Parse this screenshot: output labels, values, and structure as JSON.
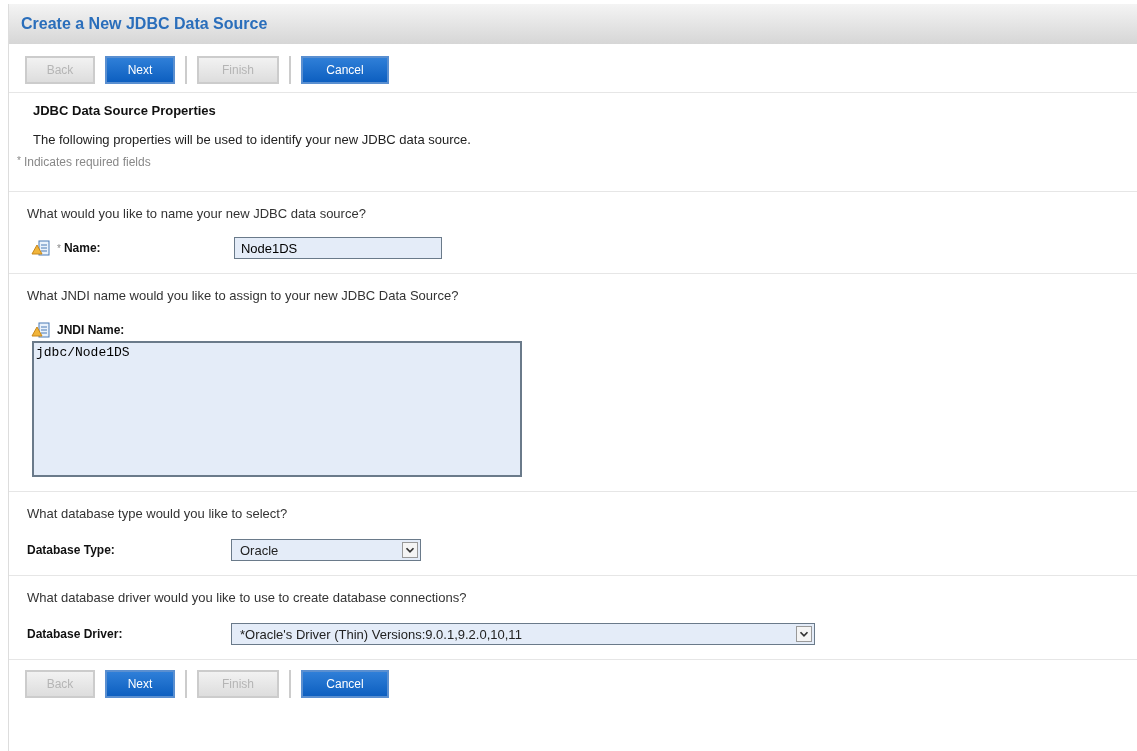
{
  "header": {
    "title": "Create a New JDBC Data Source"
  },
  "toolbar_top": [
    {
      "label": "Back",
      "disabled": true
    },
    {
      "label": "Next",
      "disabled": false
    },
    {
      "label": "Finish",
      "disabled": true
    },
    {
      "label": "Cancel",
      "disabled": false
    }
  ],
  "properties": {
    "title": "JDBC Data Source Properties",
    "description": "The following properties will be used to identify your new JDBC data source.",
    "required_note": "Indicates required fields",
    "required_mark": "*"
  },
  "questions": [
    {
      "prompt": "What would you like to name your new JDBC data source?",
      "field": {
        "kind": "text",
        "label": "Name:",
        "required": true,
        "icon": true,
        "value": "Node1DS"
      }
    },
    {
      "prompt": "What JNDI name would you like to assign to your new JDBC Data Source?",
      "field": {
        "kind": "textarea",
        "label": "JNDI Name:",
        "required": false,
        "icon": true,
        "value": "jdbc/Node1DS"
      }
    },
    {
      "prompt": "What database type would you like to select?",
      "field": {
        "kind": "select",
        "label": "Database Type:",
        "required": false,
        "icon": false,
        "value": "Oracle",
        "wide": false
      }
    },
    {
      "prompt": "What database driver would you like to use to create database connections?",
      "field": {
        "kind": "select",
        "label": "Database Driver:",
        "required": false,
        "icon": false,
        "value": "*Oracle's Driver (Thin) Versions:9.0.1,9.2.0,10,11",
        "wide": true
      }
    }
  ],
  "toolbar_bottom": [
    {
      "label": "Back",
      "disabled": true
    },
    {
      "label": "Next",
      "disabled": false
    },
    {
      "label": "Finish",
      "disabled": true
    },
    {
      "label": "Cancel",
      "disabled": false
    }
  ]
}
